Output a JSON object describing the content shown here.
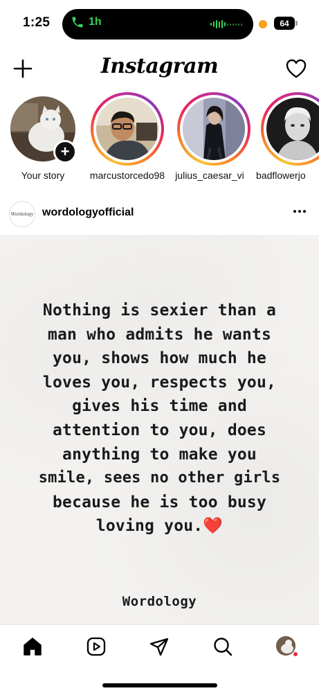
{
  "status_bar": {
    "time": "1:25",
    "call_duration": "1h",
    "battery": "64",
    "call_color": "#35d35a",
    "privacy_dot_color": "#f7a21a"
  },
  "header": {
    "logo": "Instagram",
    "new_post_icon": "plus-icon",
    "notifications_icon": "heart-icon"
  },
  "stories": [
    {
      "username": "Your story",
      "own": true
    },
    {
      "username": "marcustorcedo98"
    },
    {
      "username": "julius_caesar_vi"
    },
    {
      "username": "badflowerjo"
    }
  ],
  "post": {
    "avatar_text": "Wordology",
    "username": "wordologyofficial",
    "quote_lines": [
      "Nothing is sexier than a",
      "man who admits he wants",
      "you, shows how much he",
      "loves you, respects you,",
      "gives his time and",
      "attention to you, does",
      "anything to make you",
      "smile, sees no other girls",
      "because he is too busy",
      "loving you."
    ],
    "quote_heart": "❤️",
    "signature": "Wordology"
  },
  "bottom_nav": {
    "items": [
      "home-icon",
      "reels-icon",
      "direct-icon",
      "search-icon",
      "profile-avatar"
    ],
    "notification_dot_color": "#ed2a3f"
  }
}
